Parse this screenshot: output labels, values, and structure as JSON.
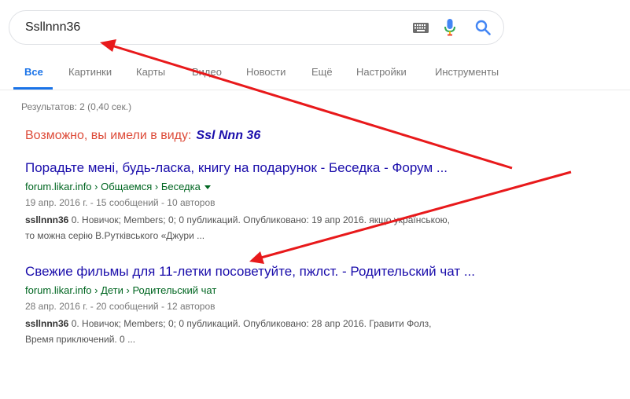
{
  "search": {
    "query": "Ssllnnn36"
  },
  "tabs": [
    {
      "label": "Все"
    },
    {
      "label": "Картинки"
    },
    {
      "label": "Карты"
    },
    {
      "label": "Видео"
    },
    {
      "label": "Новости"
    },
    {
      "label": "Ещё"
    },
    {
      "label": "Настройки"
    },
    {
      "label": "Инструменты"
    }
  ],
  "stats": "Результатов: 2 (0,40 сек.)",
  "didyoumean": {
    "prefix": "Возможно, вы имели в виду:",
    "suggestion": "Ssl Nnn 36"
  },
  "results": [
    {
      "title": "Порадьте мені, будь-ласка, книгу на подарунок - Беседка - Форум ...",
      "url": "forum.likar.info › Общаемся › Беседка",
      "meta": "19 апр. 2016 г. - 15 сообщений - 10 авторов",
      "snippet_bold": "ssllnnn36",
      "snippet_line1": " 0. Новичок; Members; 0; 0 публикаций. Опубликовано: 19 апр 2016. якщо українською,",
      "snippet_line2": "то можна серію В.Рутківського «Джури ..."
    },
    {
      "title": "Свежие фильмы для 11-летки посоветуйте, пжлст. - Родительский чат ...",
      "url": "forum.likar.info › Дети › Родительский чат",
      "meta": "28 апр. 2016 г. - 20 сообщений - 12 авторов",
      "snippet_bold": "ssllnnn36",
      "snippet_line1": " 0. Новичок; Members; 0; 0 публикаций. Опубликовано: 28 апр 2016. Гравити Фолз,",
      "snippet_line2": "Время приключений. 0 ..."
    }
  ],
  "colors": {
    "accent": "#1a73e8",
    "link": "#1a0dab",
    "url_green": "#006621",
    "didyoumean_red": "#dd4b39",
    "annotation_arrow": "#e8191b"
  }
}
